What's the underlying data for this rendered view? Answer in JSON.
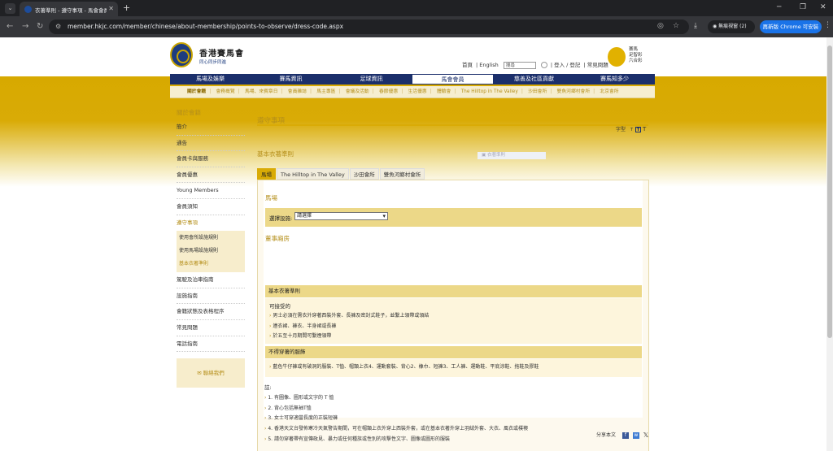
{
  "browser": {
    "tab_title": "衣著準則 - 遵守事項 - 馬會會員",
    "new_tab": "+",
    "url": "member.hkjc.com/member/chinese/about-membership/points-to-observe/dress-code.aspx",
    "profile_label": "無痕視窗 (2)",
    "update_label": "再新版 Chrome 可安裝"
  },
  "header": {
    "logo_title": "香港賽馬會",
    "logo_sub": "同心同步同進",
    "links": [
      "首頁",
      "English"
    ],
    "search_placeholder": "搜尋",
    "login": "登入 / 登記",
    "faq": "常見問題",
    "badge_text": [
      "賽馬",
      "足智彩",
      "六合彩"
    ]
  },
  "mainnav": [
    "馬場及娛樂",
    "賽馬資訊",
    "足球資訊",
    "馬會會員",
    "慈善及社區貢獻",
    "賽馬知多少"
  ],
  "mainnav_active": 3,
  "subnav": [
    "關於會籍",
    "會務概覽",
    "馬場、來賓章日",
    "會員雜誌",
    "馬主專區",
    "會議及活動",
    "春節優惠",
    "生活優惠",
    "體驗會",
    "The Hilltop in The Valley",
    "沙田會所",
    "雙魚河鄉村會所",
    "北京會所"
  ],
  "sidebar": {
    "heading": "關於會籍",
    "items_top": [
      "簡介",
      "通告",
      "會員卡與服務",
      "會員優惠",
      "Young Members",
      "會員須知"
    ],
    "active_item": "遵守事項",
    "sub_items": [
      "使用會所設施規則",
      "使用馬場設施規則",
      "基本衣著準則"
    ],
    "items_bottom": [
      "駕駛及泊車指南",
      "設施指南",
      "會籍狀態及表格程序",
      "常見問題",
      "電話指南"
    ],
    "contact": "聯絡我們"
  },
  "content": {
    "page_title": "遵守事項",
    "font_label": "字型",
    "font_small": "T",
    "font_large": "T",
    "section_title": "基本衣著準則",
    "ghost_text": "衣著準則",
    "tabs": [
      "馬場",
      "The Hilltop in The Valley",
      "沙田會所",
      "雙魚河鄉村會所"
    ],
    "panel_title": "馬場",
    "select_label": "選擇設施:",
    "select_value": "請選擇",
    "subtitle": "董事廂房",
    "block1_header": "基本衣著準則",
    "block1_sub": "可接受的",
    "block1_items": [
      "男士必須在需衣外穿著西裝外套、長褲及密封式鞋子，並繫上領帶或領結",
      "連衣裙、褲衣、半身裙或長褲",
      "於五至十月期間可繫煙領帶"
    ],
    "block2_header": "不得穿著的服飾",
    "block2_items": [
      "藍色牛仔褲或有破洞的服裝、T恤、帽類上衣4、運動套裝、背心2、橡巾、短褲3、工人褲、運動鞋、平底涼鞋、拖鞋及膠鞋"
    ],
    "notes_header": "註:",
    "notes": [
      "1. 有圖像、圖形或文字的 T 恤",
      "2. 背心包括無袖T恤",
      "3. 女士可穿適當長度的正裝短褲",
      "4. 香港天文台發佈寒冷天氣警告期間，可在帽類上衣外穿上西裝外套，或在基本衣著外穿上羽絨外套、大衣、風衣或樸襖",
      "5. 請勿穿著帶有宣傳政見、暴力或任何種族或性別的攻擊性文字、圖像或圖形的服裝"
    ],
    "share_label": "分享本文"
  }
}
